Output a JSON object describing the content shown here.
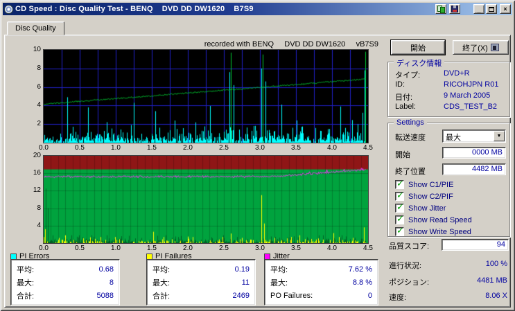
{
  "window": {
    "title": "CD Speed : Disc Quality Test - BENQ    DVD DD DW1620    B7S9",
    "tab": "Disc Quality",
    "controls": {
      "minimize": "_",
      "close": "×"
    }
  },
  "chart_header": "recorded with BENQ     DVD DD DW1620     vB7S9",
  "ui": {
    "check_glyph": "✓",
    "dropdown_arrow": "▼"
  },
  "buttons": {
    "start": "開始",
    "exit": "終了(X)"
  },
  "disc_info": {
    "legend": "ディスク情報",
    "rows": [
      {
        "label": "タイプ:",
        "value": "DVD+R"
      },
      {
        "label": "ID:",
        "value": "RICOHJPN R01"
      },
      {
        "label": "日付:",
        "value": "9 March 2005"
      },
      {
        "label": "Label:",
        "value": "CDS_TEST_B2"
      }
    ]
  },
  "settings": {
    "legend": "Settings",
    "speed": {
      "label": "転送速度",
      "value": "最大"
    },
    "start": {
      "label": "開始",
      "value": "0000 MB"
    },
    "end": {
      "label": "終了位置",
      "value": "4482 MB"
    },
    "checkboxes": [
      {
        "label": "Show C1/PIE",
        "checked": true
      },
      {
        "label": "Show C2/PIF",
        "checked": true
      },
      {
        "label": "Show Jitter",
        "checked": true
      },
      {
        "label": "Show Read Speed",
        "checked": true
      },
      {
        "label": "Show Write Speed",
        "checked": true
      }
    ]
  },
  "score": {
    "label": "品質スコア:",
    "value": "94"
  },
  "status": [
    {
      "label": "進行状況:",
      "value": "100 %"
    },
    {
      "label": "ポジション:",
      "value": "4481 MB"
    },
    {
      "label": "速度:",
      "value": "8.06 X"
    }
  ],
  "stat_boxes": [
    {
      "legend": "PI Errors",
      "color": "#00FFFF",
      "rows": [
        {
          "label": "平均:",
          "value": "0.68"
        },
        {
          "label": "最大:",
          "value": "8"
        },
        {
          "label": "合計:",
          "value": "5088"
        }
      ]
    },
    {
      "legend": "PI Failures",
      "color": "#FFFF00",
      "rows": [
        {
          "label": "平均:",
          "value": "0.19"
        },
        {
          "label": "最大:",
          "value": "11"
        },
        {
          "label": "合計:",
          "value": "2469"
        }
      ]
    },
    {
      "legend": "Jitter",
      "color": "#FF00FF",
      "rows": [
        {
          "label": "平均:",
          "value": "7.62 %"
        },
        {
          "label": "最大:",
          "value": "8.8 %"
        },
        {
          "label": "PO Failures:",
          "value": "0"
        }
      ]
    }
  ],
  "colors": {
    "window_bg": "#d4d0c8",
    "titlebar_left": "#0a246a",
    "titlebar_right": "#a6caf0",
    "value_text": "#0000a0",
    "check_green": "#00a000"
  },
  "charts": {
    "x_max": 4.5,
    "data_end": 4.47,
    "x_ticks": [
      "0.0",
      "0.5",
      "1.0",
      "1.5",
      "2.0",
      "2.5",
      "3.0",
      "3.5",
      "4.0",
      "4.5"
    ],
    "top": {
      "y_max": 10,
      "y_ticks": [
        "10",
        "8",
        "6",
        "4",
        "2"
      ],
      "bg": "#000000",
      "grid_color": "#2020c8",
      "spike_color": "#00FFFF",
      "line_color": "#00C832",
      "noise_mean": 0.5,
      "speed_start": 4.15,
      "speed_end": 6.85,
      "big_spikes": [
        [
          0.33,
          4.9
        ],
        [
          0.62,
          3.8
        ],
        [
          1.25,
          4.3
        ],
        [
          1.55,
          3.4
        ],
        [
          2.58,
          7.6
        ],
        [
          2.63,
          6.2
        ],
        [
          3.02,
          8.0
        ],
        [
          3.08,
          6.6
        ],
        [
          3.3,
          4.1
        ],
        [
          4.12,
          3.9
        ],
        [
          4.45,
          7.8
        ]
      ],
      "line_spikes": [
        [
          2.6,
          9.7
        ],
        [
          3.04,
          9.5
        ],
        [
          4.46,
          9.8
        ]
      ]
    },
    "bottom": {
      "y_max": 20,
      "y_ticks": [
        "20",
        "16",
        "12",
        "8",
        "4"
      ],
      "bg": "#00A33E",
      "danger_color": "#8F1616",
      "danger_from": 16.9,
      "grid_alpha": 0.2,
      "pif_color": "#FFFF00",
      "jitter_color": "#FF30FF",
      "jitter_base": 15.24,
      "jitter_end": 16.9,
      "jitter_max": 17.6,
      "pif_big_spikes": [
        [
          0.02,
          3.2
        ],
        [
          0.3,
          1.8
        ],
        [
          1.52,
          2.6
        ],
        [
          2.0,
          1.5
        ],
        [
          2.6,
          2.2
        ],
        [
          3.02,
          11.0
        ],
        [
          3.06,
          4.5
        ],
        [
          3.55,
          1.8
        ],
        [
          4.02,
          2.3
        ],
        [
          4.44,
          3.6
        ]
      ],
      "left_spikes": [
        [
          0.03,
          12.5
        ],
        [
          0.06,
          8.0
        ]
      ]
    }
  }
}
